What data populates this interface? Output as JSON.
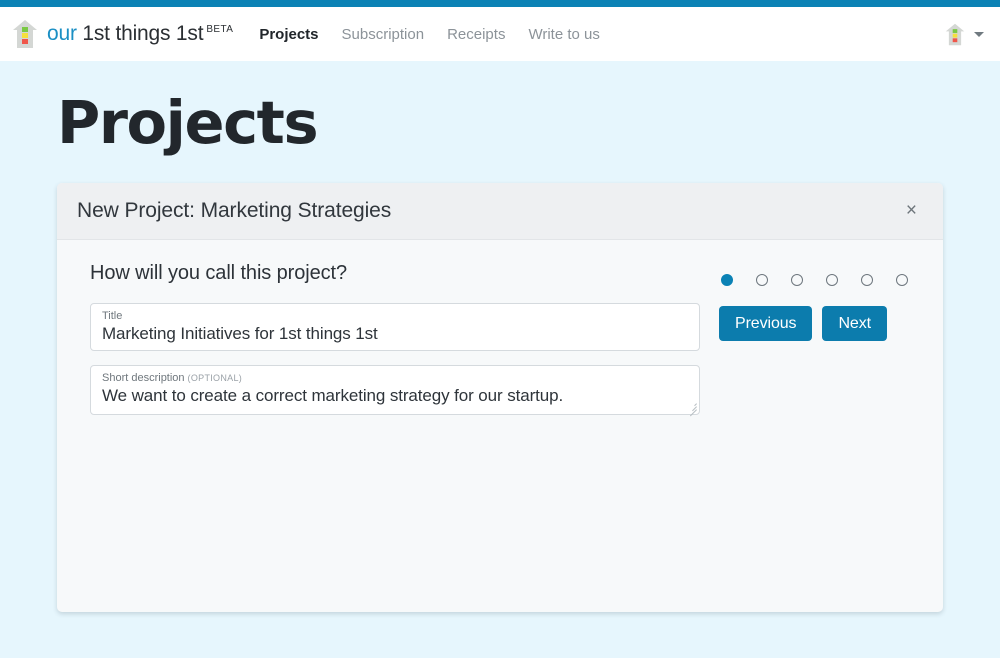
{
  "theme": {
    "accent_blue": "#0b82b5",
    "button_blue": "#0c7cad",
    "page_background": "#e6f6fd",
    "card_body_background": "#f7f9fa",
    "card_header_background": "#eef0f2"
  },
  "navbar": {
    "logo_icon": "house-logo-icon",
    "brand_prefix": "our",
    "brand_name": "1st things 1st",
    "brand_badge": "BETA",
    "links": [
      {
        "label": "Projects",
        "active": true
      },
      {
        "label": "Subscription",
        "active": false
      },
      {
        "label": "Receipts",
        "active": false
      },
      {
        "label": "Write to us",
        "active": false
      }
    ],
    "account": {
      "avatar_icon": "house-avatar-icon",
      "caret_icon": "chevron-down-icon"
    }
  },
  "page": {
    "title": "Projects"
  },
  "card": {
    "header_title": "New Project: Marketing Strategies",
    "close_label": "×",
    "question": "How will you call this project?",
    "fields": [
      {
        "name": "title",
        "label": "Title",
        "optional_tag": "",
        "value": "Marketing Initiatives for 1st things 1st",
        "placeholder": "Title"
      },
      {
        "name": "short-description",
        "label": "Short description",
        "optional_tag": "(OPTIONAL)",
        "value": "We want to create a correct marketing strategy for our startup.",
        "placeholder": "Short description"
      }
    ],
    "steps": {
      "total": 6,
      "current": 1
    },
    "buttons": {
      "previous": "Previous",
      "next": "Next"
    }
  }
}
